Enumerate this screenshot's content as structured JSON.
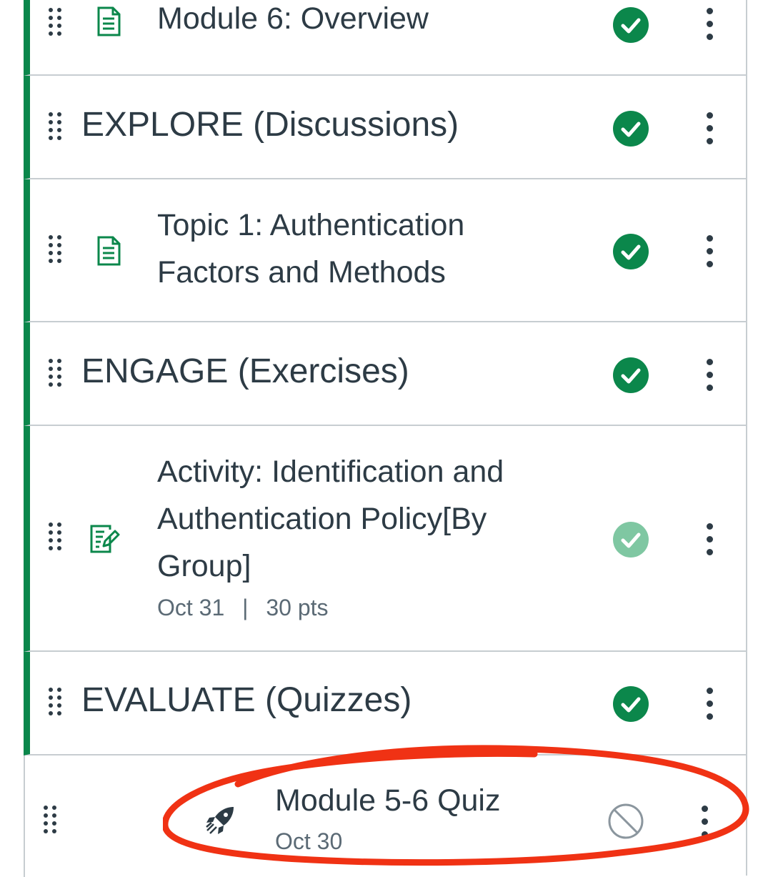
{
  "colors": {
    "published": "#0b874b",
    "published_light": "#7fc7a2",
    "unpublished": "#8b969e",
    "annotation": "#f03214",
    "text": "#2d3b45"
  },
  "items": [
    {
      "kind": "item",
      "icon": "page-icon",
      "title": "Module 6: Overview",
      "status": "published"
    },
    {
      "kind": "header",
      "title": "EXPLORE (Discussions)",
      "status": "published"
    },
    {
      "kind": "item",
      "icon": "page-icon",
      "title_lines": [
        "Topic 1: Authentication",
        "Factors and Methods"
      ],
      "status": "published"
    },
    {
      "kind": "header",
      "title": "ENGAGE (Exercises)",
      "status": "published"
    },
    {
      "kind": "item",
      "icon": "assignment-icon",
      "title_lines": [
        "Activity: Identification and",
        "Authentication Policy[By",
        "Group]"
      ],
      "due": "Oct 31",
      "separator": "|",
      "points": "30 pts",
      "status": "published-light"
    },
    {
      "kind": "header",
      "title": "EVALUATE (Quizzes)",
      "status": "published"
    },
    {
      "kind": "item",
      "icon": "quiz-rocket-icon",
      "title": "Module 5-6 Quiz",
      "due": "Oct 30",
      "status": "unpublished"
    }
  ]
}
